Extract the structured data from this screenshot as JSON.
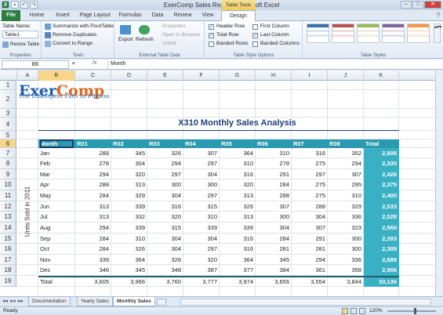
{
  "window": {
    "title": "ExerComp Sales Report - Microsoft Excel",
    "context_tab_group": "Table Tools"
  },
  "tabs": [
    "File",
    "Home",
    "Insert",
    "Page Layout",
    "Formulas",
    "Data",
    "Review",
    "View",
    "Design"
  ],
  "ribbon": {
    "properties": {
      "table_name_label": "Table Name:",
      "table_name_value": "Table1",
      "resize_label": "Resize Table",
      "group_label": "Properties"
    },
    "tools": {
      "summarize": "Summarize with PivotTable",
      "remove_duplicates": "Remove Duplicates",
      "convert": "Convert to Range",
      "group_label": "Tools"
    },
    "external": {
      "export": "Export",
      "refresh": "Refresh",
      "properties": "Properties",
      "open_browser": "Open in Browser",
      "unlink": "Unlink",
      "group_label": "External Table Data"
    },
    "style_options": {
      "header_row": "Header Row",
      "total_row": "Total Row",
      "banded_rows": "Banded Rows",
      "first_column": "First Column",
      "last_column": "Last Column",
      "banded_columns": "Banded Columns",
      "group_label": "Table Style Options"
    },
    "table_styles": {
      "group_label": "Table Styles"
    }
  },
  "formula_bar": {
    "name_box": "B6",
    "fx": "fx",
    "content": "Month"
  },
  "columns": [
    "A",
    "B",
    "C",
    "D",
    "E",
    "F",
    "G",
    "H",
    "I",
    "J",
    "K"
  ],
  "rows": [
    "1",
    "2",
    "3",
    "4",
    "5",
    "6",
    "7",
    "8",
    "9",
    "10",
    "11",
    "12",
    "13",
    "14",
    "15",
    "16",
    "17",
    "18",
    "19"
  ],
  "logo": {
    "exer": "Exer",
    "comp": "Comp",
    "tagline": "The Intelligent Path to Fitness"
  },
  "report_title": "X310 Monthly Sales Analysis",
  "side_label": "Units Sold in 2011",
  "table": {
    "headers": [
      "Month",
      "R01",
      "R02",
      "R03",
      "R04",
      "R05",
      "R06",
      "R07",
      "R08",
      "Total"
    ],
    "rows": [
      [
        "Jan",
        "288",
        "345",
        "326",
        "307",
        "364",
        "310",
        "316",
        "352",
        "2,608"
      ],
      [
        "Feb",
        "278",
        "304",
        "294",
        "297",
        "310",
        "278",
        "275",
        "294",
        "2,330"
      ],
      [
        "Mar",
        "294",
        "320",
        "297",
        "304",
        "316",
        "291",
        "297",
        "307",
        "2,426"
      ],
      [
        "Apr",
        "288",
        "313",
        "300",
        "300",
        "320",
        "284",
        "275",
        "295",
        "2,375"
      ],
      [
        "May",
        "284",
        "329",
        "304",
        "297",
        "313",
        "288",
        "275",
        "310",
        "2,400"
      ],
      [
        "Jun",
        "313",
        "339",
        "316",
        "315",
        "326",
        "307",
        "288",
        "329",
        "2,533"
      ],
      [
        "Jul",
        "313",
        "332",
        "320",
        "310",
        "313",
        "300",
        "304",
        "336",
        "2,528"
      ],
      [
        "Aug",
        "294",
        "339",
        "315",
        "339",
        "339",
        "304",
        "307",
        "323",
        "2,560"
      ],
      [
        "Sep",
        "284",
        "310",
        "304",
        "304",
        "316",
        "284",
        "291",
        "300",
        "2,393"
      ],
      [
        "Oct",
        "284",
        "326",
        "304",
        "297",
        "316",
        "281",
        "281",
        "300",
        "2,389"
      ],
      [
        "Nov",
        "339",
        "364",
        "326",
        "320",
        "364",
        "345",
        "294",
        "336",
        "2,688"
      ],
      [
        "Dec",
        "346",
        "345",
        "348",
        "387",
        "377",
        "384",
        "361",
        "358",
        "2,906"
      ]
    ],
    "total_row": [
      "Total",
      "3,605",
      "3,966",
      "3,760",
      "3,777",
      "3,974",
      "3,656",
      "3,554",
      "3,844",
      "30,136"
    ]
  },
  "sheets": [
    "Documentation",
    "Yearly Sales",
    "Monthly Sales"
  ],
  "status": {
    "ready": "Ready",
    "zoom": "120%"
  },
  "colors": {
    "header_teal": "#2a9aae",
    "total_teal": "#3ab0c4",
    "logo_blue": "#1f5ea8",
    "logo_orange": "#e0661c",
    "title_blue": "#1f3f7a"
  }
}
